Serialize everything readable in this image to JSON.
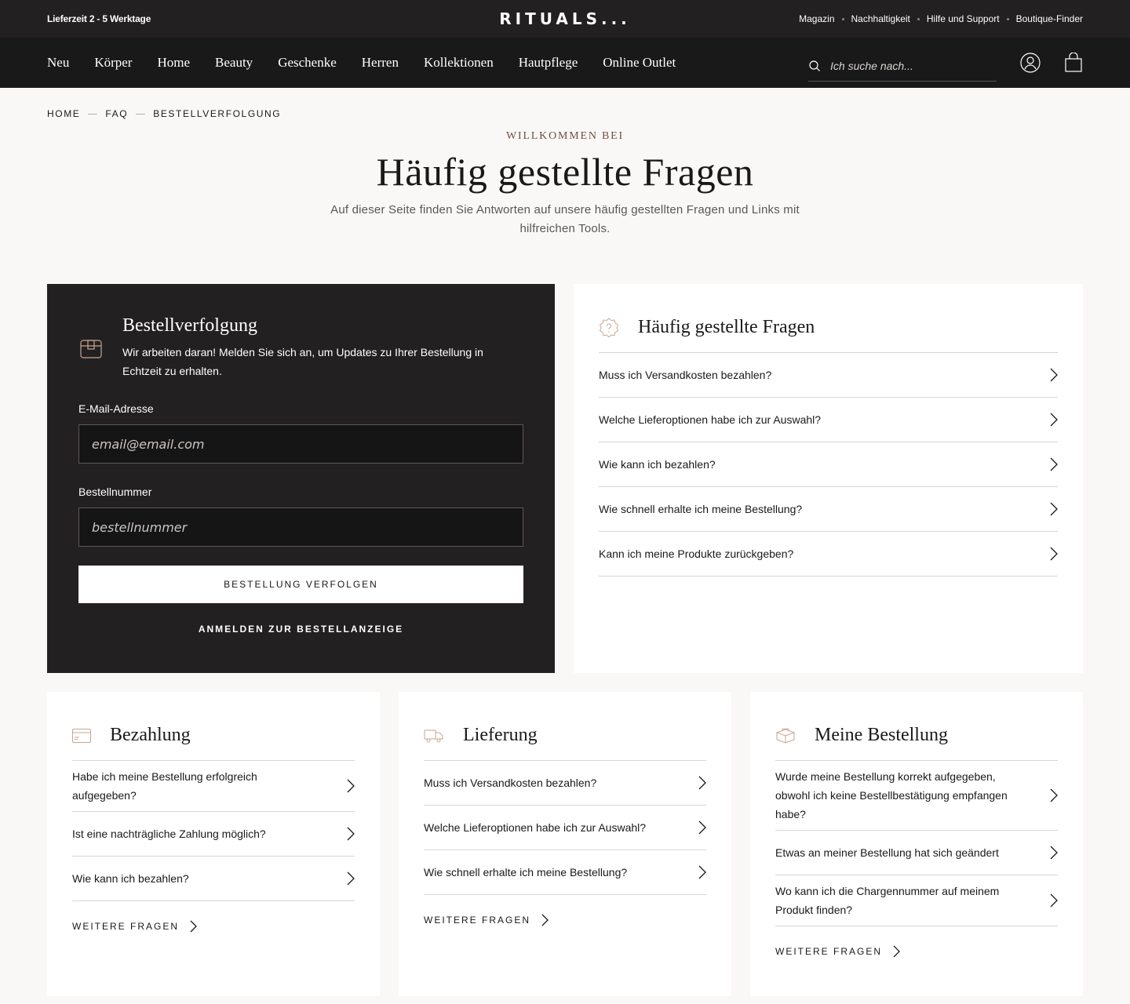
{
  "topbar": {
    "delivery": "Lieferzeit 2 - 5 Werktage",
    "logo": "RITUALS...",
    "links": [
      "Magazin",
      "Nachhaltigkeit",
      "Hilfe und Support",
      "Boutique-Finder"
    ]
  },
  "nav": {
    "items": [
      "Neu",
      "Körper",
      "Home",
      "Beauty",
      "Geschenke",
      "Herren",
      "Kollektionen",
      "Hautpflege",
      "Online Outlet"
    ],
    "search_placeholder": "Ich suche nach..."
  },
  "breadcrumb": [
    "HOME",
    "FAQ",
    "BESTELLVERFOLGUNG"
  ],
  "hero": {
    "eyebrow": "WILLKOMMEN BEI",
    "title": "Häufig gestellte Fragen",
    "subtitle": "Auf dieser Seite finden Sie Antworten auf unsere häufig gestellten Fragen und Links mit hilfreichen Tools."
  },
  "tracking": {
    "title": "Bestellverfolgung",
    "description": "Wir arbeiten daran! Melden Sie sich an, um Updates zu Ihrer Bestellung in Echtzeit zu erhalten.",
    "email_label": "E-Mail-Adresse",
    "email_placeholder": "email@email.com",
    "order_label": "Bestellnummer",
    "order_placeholder": "bestellnummer",
    "submit": "BESTELLUNG VERFOLGEN",
    "login": "ANMELDEN ZUR BESTELLANZEIGE"
  },
  "faq_main": {
    "title": "Häufig gestellte Fragen",
    "items": [
      "Muss ich Versandkosten bezahlen?",
      "Welche Lieferoptionen habe ich zur Auswahl?",
      "Wie kann ich bezahlen?",
      "Wie schnell erhalte ich meine Bestellung?",
      "Kann ich meine Produkte zurückgeben?"
    ]
  },
  "categories": [
    {
      "title": "Bezahlung",
      "icon": "credit-card-icon",
      "items": [
        "Habe ich meine Bestellung erfolgreich aufgegeben?",
        "Ist eine nachträgliche Zahlung möglich?",
        "Wie kann ich bezahlen?"
      ],
      "more": "WEITERE FRAGEN"
    },
    {
      "title": "Lieferung",
      "icon": "delivery-truck-icon",
      "items": [
        "Muss ich Versandkosten bezahlen?",
        "Welche Lieferoptionen habe ich zur Auswahl?",
        "Wie schnell erhalte ich meine Bestellung?"
      ],
      "more": "WEITERE FRAGEN"
    },
    {
      "title": "Meine Bestellung",
      "icon": "gift-box-icon",
      "items": [
        "Wurde meine Bestellung korrekt aufgegeben, obwohl ich keine Bestellbestätigung empfangen habe?",
        "Etwas an meiner Bestellung hat sich geändert",
        "Wo kann ich die Chargennummer auf meinem Produkt finden?"
      ],
      "more": "WEITERE FRAGEN"
    }
  ]
}
